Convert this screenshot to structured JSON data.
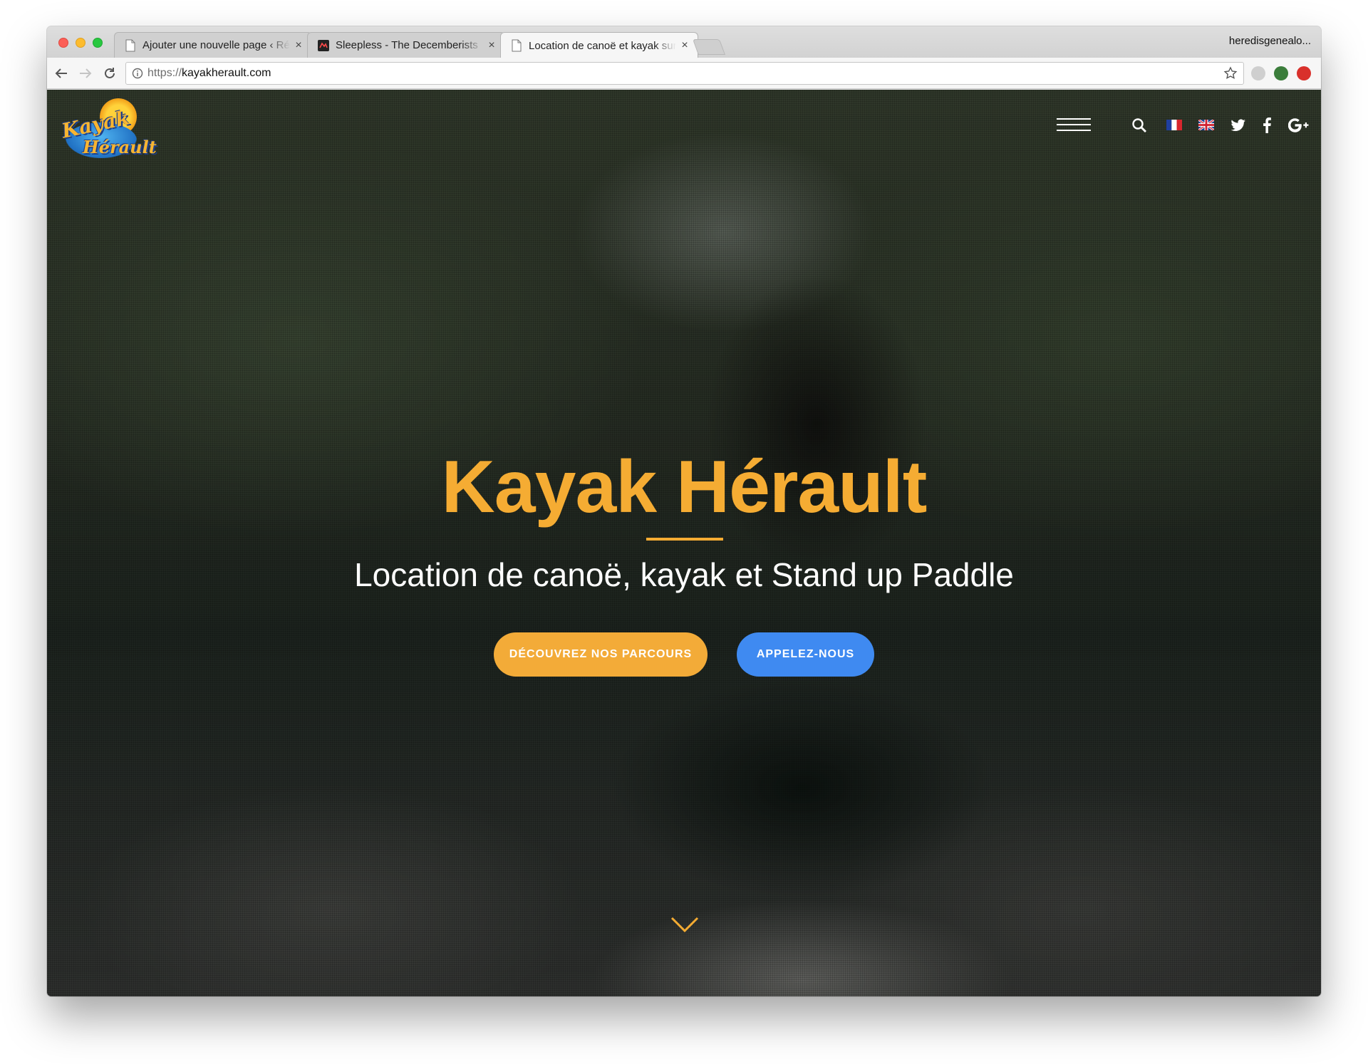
{
  "browser": {
    "tabs": [
      {
        "title": "Ajouter une nouvelle page ‹ Ré",
        "active": false
      },
      {
        "title": "Sleepless - The Decemberists",
        "active": false
      },
      {
        "title": "Location de canoë et kayak sur",
        "active": true
      }
    ],
    "profile_name": "heredisgenealo...",
    "url_scheme": "https://",
    "url_host": "kayakherault.com"
  },
  "site": {
    "logo": {
      "line1": "Kayak",
      "line2": "Hérault"
    },
    "nav_icons": [
      "menu-icon",
      "search-icon",
      "flag-fr-icon",
      "flag-uk-icon",
      "twitter-icon",
      "facebook-icon",
      "google-plus-icon"
    ],
    "hero": {
      "title": "Kayak Hérault",
      "subtitle": "Location de canoë, kayak et Stand up Paddle",
      "cta_primary": "DÉCOUVREZ NOS PARCOURS",
      "cta_secondary": "APPELEZ-NOUS"
    },
    "colors": {
      "accent": "#f5ac33",
      "secondary": "#3f8af1"
    }
  }
}
